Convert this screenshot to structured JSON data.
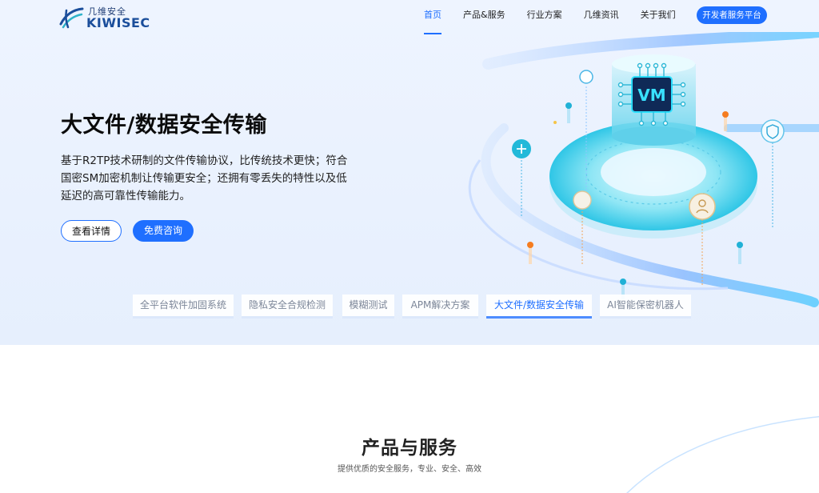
{
  "header": {
    "logo_cn": "几维安全",
    "logo_en": "KIWISEC",
    "nav": [
      "首页",
      "产品&服务",
      "行业方案",
      "几维资讯",
      "关于我们"
    ],
    "dev_button": "开发者服务平台"
  },
  "hero": {
    "title": "大文件/数据安全传输",
    "description": "基于R2TP技术研制的文件传输协议，比传统技术更快；符合国密SM加密机制让传输更安全；还拥有零丢失的特性以及低延迟的高可靠性传输能力。",
    "btn_details": "查看详情",
    "btn_consult": "免费咨询",
    "art_label": "VM"
  },
  "tabs": [
    "全平台软件加固系统",
    "隐私安全合规检测",
    "模糊测试",
    "APM解决方案",
    "大文件/数据安全传输",
    "AI智能保密机器人"
  ],
  "active_tab": 4,
  "section": {
    "title": "产品与服务",
    "subtitle": "提供优质的安全服务，专业、安全、高效"
  },
  "colors": {
    "accent": "#1f6fff",
    "hero_bg": "#eaf1fe"
  }
}
